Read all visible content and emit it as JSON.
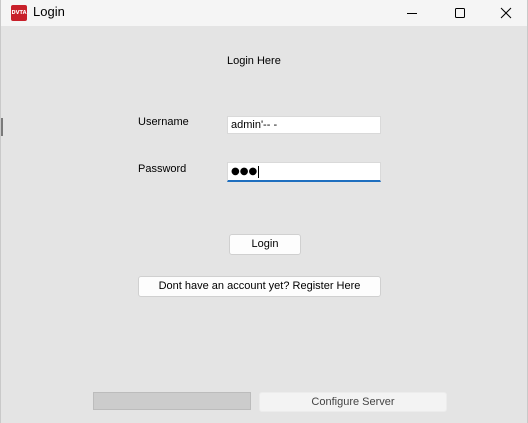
{
  "window": {
    "title": "Login",
    "icon_text": "DVTA"
  },
  "form": {
    "heading": "Login Here",
    "username_label": "Username",
    "username_value": "admin'-- -",
    "password_label": "Password",
    "password_value": "●●●"
  },
  "buttons": {
    "login": "Login",
    "register": "Dont have an account yet? Register Here",
    "configure": "Configure Server"
  },
  "colors": {
    "focus_underline": "#1f6fbf",
    "icon_red": "#c8202a"
  }
}
